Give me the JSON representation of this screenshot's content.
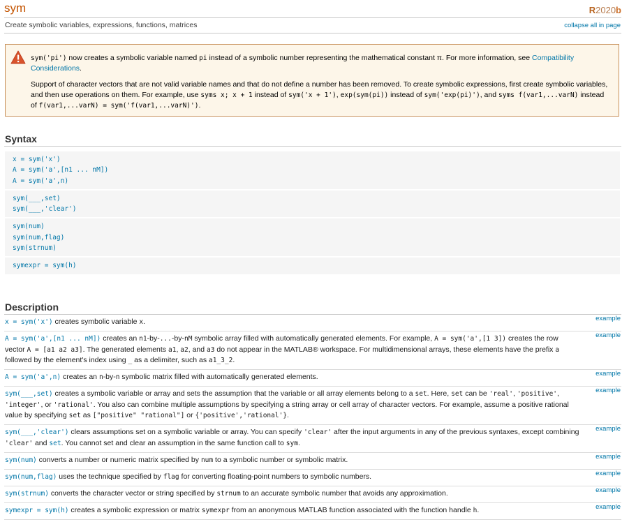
{
  "header": {
    "title": "sym",
    "subtitle": "Create symbolic variables, expressions, functions, matrices",
    "release": {
      "r": "R",
      "year": "2020",
      "suffix": "b"
    },
    "collapse_link": "collapse all in page"
  },
  "warning": {
    "p1": {
      "c1": "sym('pi')",
      "t1": " now creates a symbolic variable named ",
      "c2": "pi",
      "t2": " instead of a symbolic number representing the mathematical constant π. For more information, see ",
      "link": "Compatibility Considerations",
      "t3": "."
    },
    "p2": {
      "t1": "Support of character vectors that are not valid variable names and that do not define a number has been removed. To create symbolic expressions, first create symbolic variables, and then use operations on them. For example, use ",
      "c1": "syms x; x + 1",
      "t2": " instead of ",
      "c2": "sym('x + 1')",
      "t3": ", ",
      "c3": "exp(sym(pi))",
      "t4": " instead of ",
      "c4": "sym('exp(pi)')",
      "t5": ", and ",
      "c5": "syms f(var1,...varN)",
      "t6": " instead of ",
      "c6": "f(var1,...varN) = sym('f(var1,...varN)')",
      "t7": "."
    }
  },
  "syntax": {
    "heading": "Syntax",
    "groups": [
      [
        "x = sym('x')",
        "A = sym('a',[n1 ... nM])",
        "A = sym('a',n)"
      ],
      [
        "sym(___,set)",
        "sym(___,'clear')"
      ],
      [
        "sym(num)",
        "sym(num,flag)",
        "sym(strnum)"
      ],
      [
        "symexpr = sym(h)"
      ]
    ]
  },
  "description": {
    "heading": "Description",
    "example_label": "example",
    "rows": [
      {
        "link": "x = sym('x')",
        "parts": [
          " creates symbolic variable ",
          {
            "c": "x"
          },
          "."
        ]
      },
      {
        "link": "A = sym('a',[n1 ... nM])",
        "parts": [
          " creates an ",
          {
            "c": "n1"
          },
          "-by-",
          {
            "c": "..."
          },
          "-by-",
          {
            "c": "nM"
          },
          " symbolic array filled with automatically generated elements. For example, ",
          {
            "c": "A = sym('a',[1 3])"
          },
          " creates the row vector ",
          {
            "c": "A = [a1 a2 a3]"
          },
          ". The generated elements ",
          {
            "c": "a1"
          },
          ", ",
          {
            "c": "a2"
          },
          ", and ",
          {
            "c": "a3"
          },
          " do not appear in the MATLAB® workspace. For multidimensional arrays, these elements have the prefix ",
          {
            "c": "a"
          },
          " followed by the element's index using ",
          {
            "c": "_"
          },
          " as a delimiter, such as ",
          {
            "c": "a1_3_2"
          },
          "."
        ]
      },
      {
        "link": "A = sym('a',n)",
        "parts": [
          " creates an ",
          {
            "c": "n"
          },
          "-by-",
          {
            "c": "n"
          },
          " symbolic matrix filled with automatically generated elements."
        ]
      },
      {
        "link": "sym(___,set)",
        "parts": [
          " creates a symbolic variable or array and sets the assumption that the variable or all array elements belong to a ",
          {
            "c": "set"
          },
          ". Here, ",
          {
            "c": "set"
          },
          " can be ",
          {
            "c": "'real'"
          },
          ", ",
          {
            "c": "'positive'"
          },
          ", ",
          {
            "c": "'integer'"
          },
          ", or ",
          {
            "c": "'rational'"
          },
          ". You also can combine multiple assumptions by specifying a string array or cell array of character vectors. For example, assume a positive rational value by specifying ",
          {
            "c": "set"
          },
          " as ",
          {
            "c": "[\"positive\" \"rational\"]"
          },
          " or ",
          {
            "c": "{'positive','rational'}"
          },
          "."
        ]
      },
      {
        "link": "sym(___,'clear')",
        "parts": [
          " clears assumptions set on a symbolic variable or array. You can specify ",
          {
            "c": "'clear'"
          },
          " after the input arguments in any of the previous syntaxes, except combining ",
          {
            "c": "'clear'"
          },
          " and ",
          {
            "l": "set"
          },
          ". You cannot set and clear an assumption in the same function call to ",
          {
            "c": "sym"
          },
          "."
        ]
      },
      {
        "link": "sym(num)",
        "parts": [
          " converts a number or numeric matrix specified by ",
          {
            "c": "num"
          },
          " to a symbolic number or symbolic matrix."
        ]
      },
      {
        "link": "sym(num,flag)",
        "parts": [
          " uses the technique specified by ",
          {
            "c": "flag"
          },
          " for converting floating-point numbers to symbolic numbers."
        ]
      },
      {
        "link": "sym(strnum)",
        "parts": [
          " converts the character vector or string specified by ",
          {
            "c": "strnum"
          },
          " to an accurate symbolic number that avoids any approximation."
        ]
      },
      {
        "link": "symexpr = sym(h)",
        "parts": [
          " creates a symbolic expression or matrix ",
          {
            "c": "symexpr"
          },
          " from an anonymous MATLAB function associated with the function handle ",
          {
            "c": "h"
          },
          "."
        ]
      }
    ]
  }
}
